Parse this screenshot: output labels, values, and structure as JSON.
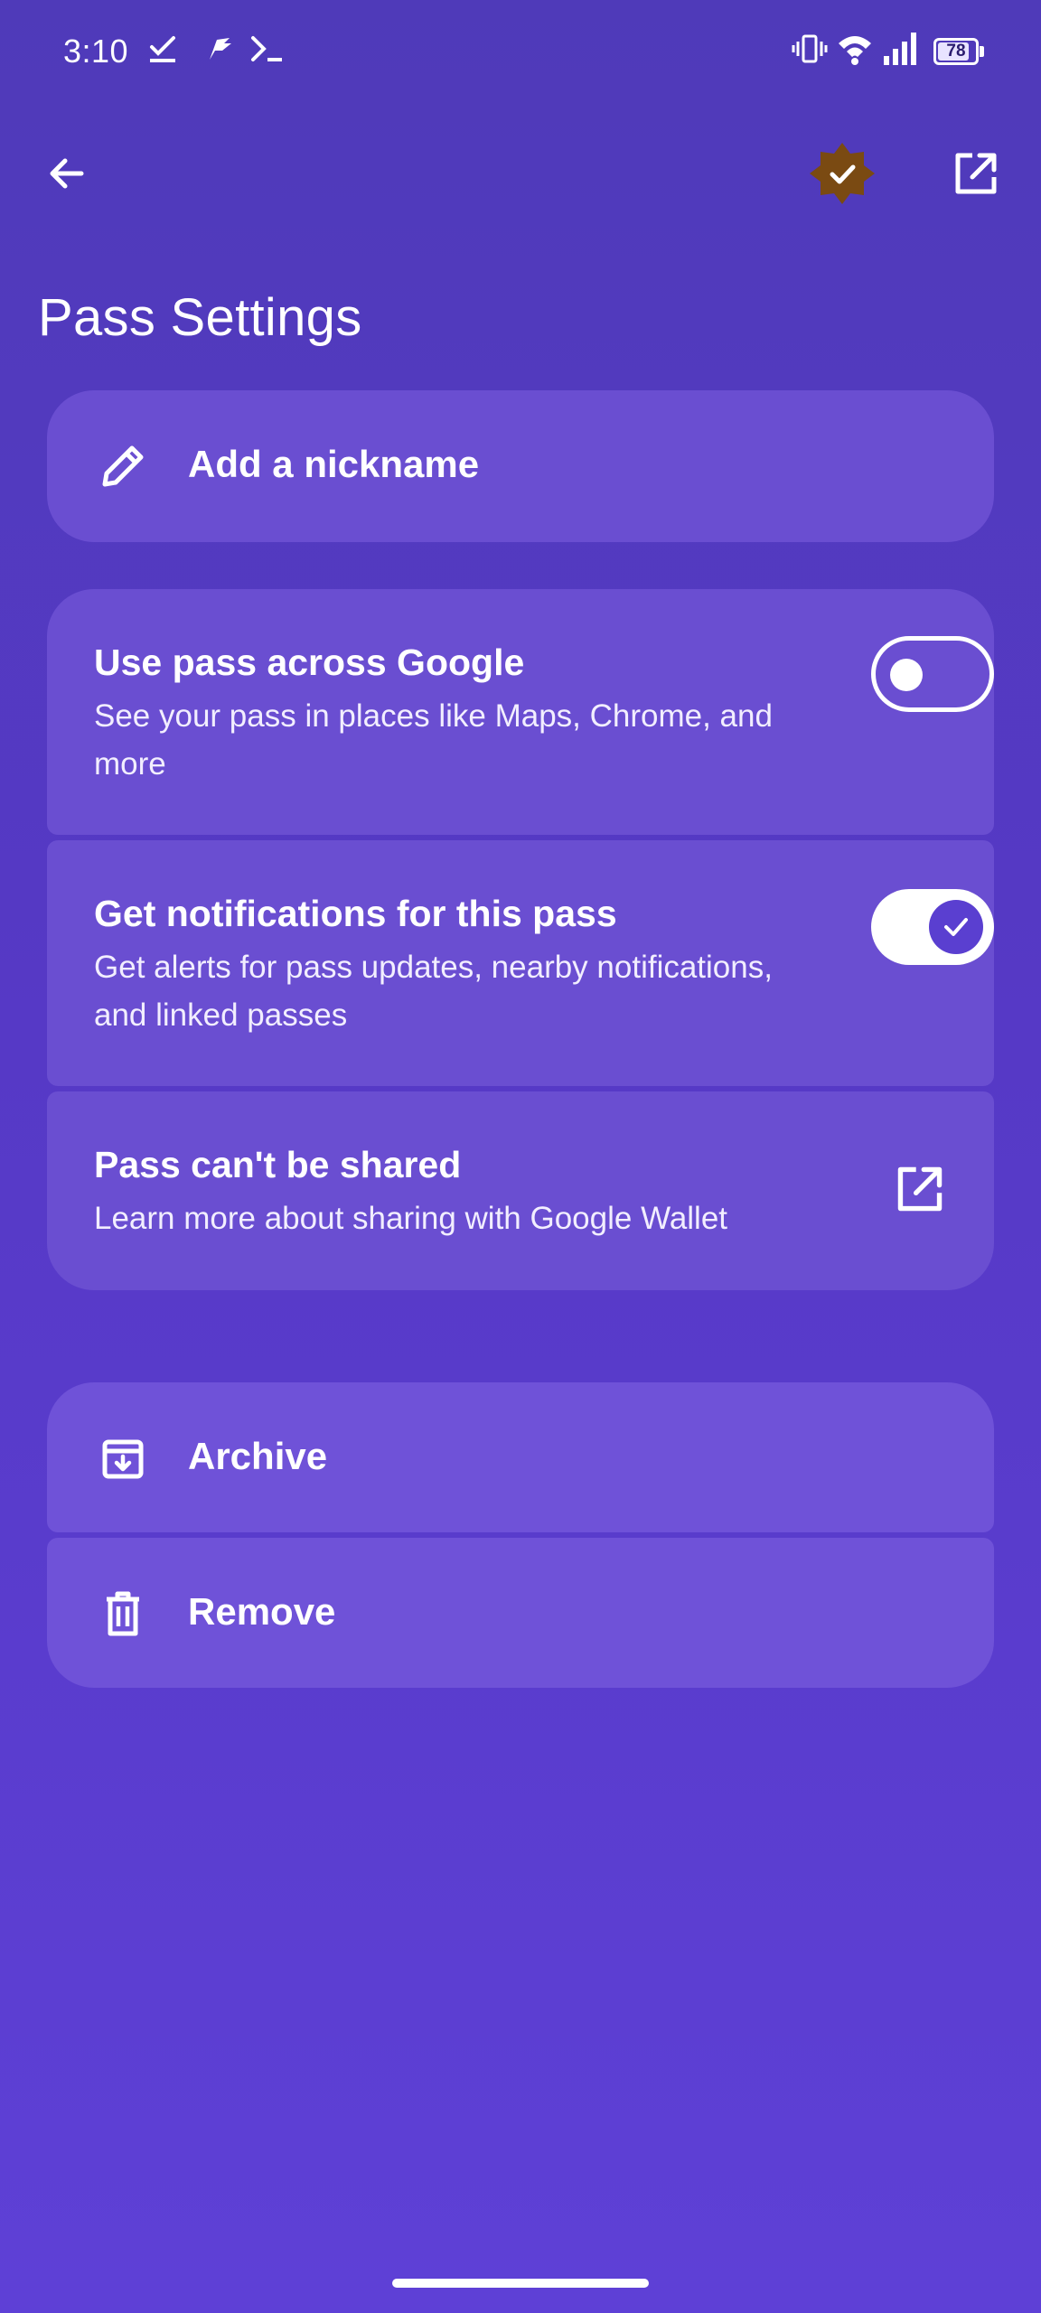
{
  "status_bar": {
    "time": "3:10",
    "left_icons": [
      "task-check-icon",
      "feather-app-icon",
      "terminal-icon"
    ],
    "right_icons": [
      "vibrate-icon",
      "wifi-icon",
      "signal-icon"
    ],
    "battery_level": "78"
  },
  "app_bar": {
    "back_icon": "arrow-back-icon",
    "badge_icon": "star-check-badge-icon",
    "open_icon": "open-in-new-icon",
    "badge_color": "#7a4a12"
  },
  "page": {
    "title": "Pass Settings"
  },
  "nickname": {
    "icon": "pencil-icon",
    "label": "Add a nickname"
  },
  "settings": [
    {
      "title": "Use pass across Google",
      "subtitle": "See your pass in places like Maps, Chrome, and more",
      "toggle_on": false
    },
    {
      "title": "Get notifications for this pass",
      "subtitle": "Get alerts for pass updates, nearby notifications, and linked passes",
      "toggle_on": true
    },
    {
      "title": "Pass can't be shared",
      "subtitle": "Learn more about sharing with Google Wallet",
      "icon": "open-in-new-icon"
    }
  ],
  "actions": [
    {
      "icon": "archive-icon",
      "label": "Archive"
    },
    {
      "icon": "trash-icon",
      "label": "Remove"
    }
  ],
  "colors": {
    "background_top": "#4f3ab9",
    "background_bottom": "#5e40d6",
    "card": "#6a4ed1",
    "toggle_knob_on": "#5a3fd0"
  }
}
